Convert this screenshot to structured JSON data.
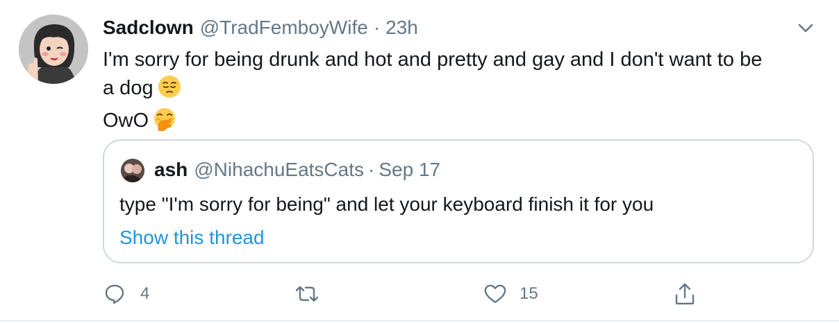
{
  "tweet": {
    "display_name": "Sadclown",
    "handle": "@TradFemboyWife",
    "separator": "·",
    "timestamp": "23h",
    "body_line1": "I'm sorry for being drunk and hot and pretty and gay and I don't want to be",
    "body_line2": "a dog",
    "body_line3": "OwO",
    "emoji1": "pensive-face",
    "emoji2": "face-with-hand-over-mouth"
  },
  "quoted": {
    "display_name": "ash",
    "handle": "@NihachuEatsCats",
    "separator": "·",
    "timestamp": "Sep 17",
    "text": "type \"I'm sorry for being\" and let your keyboard finish it for you",
    "link": "Show this thread"
  },
  "actions": {
    "reply_count": "4",
    "retweet_count": "",
    "like_count": "15"
  },
  "colors": {
    "text": "#14171a",
    "muted": "#657786",
    "link": "#1b95e0",
    "border": "#cfd9de"
  },
  "icons": [
    "chevron-down-icon",
    "reply-icon",
    "retweet-icon",
    "like-icon",
    "share-icon"
  ]
}
